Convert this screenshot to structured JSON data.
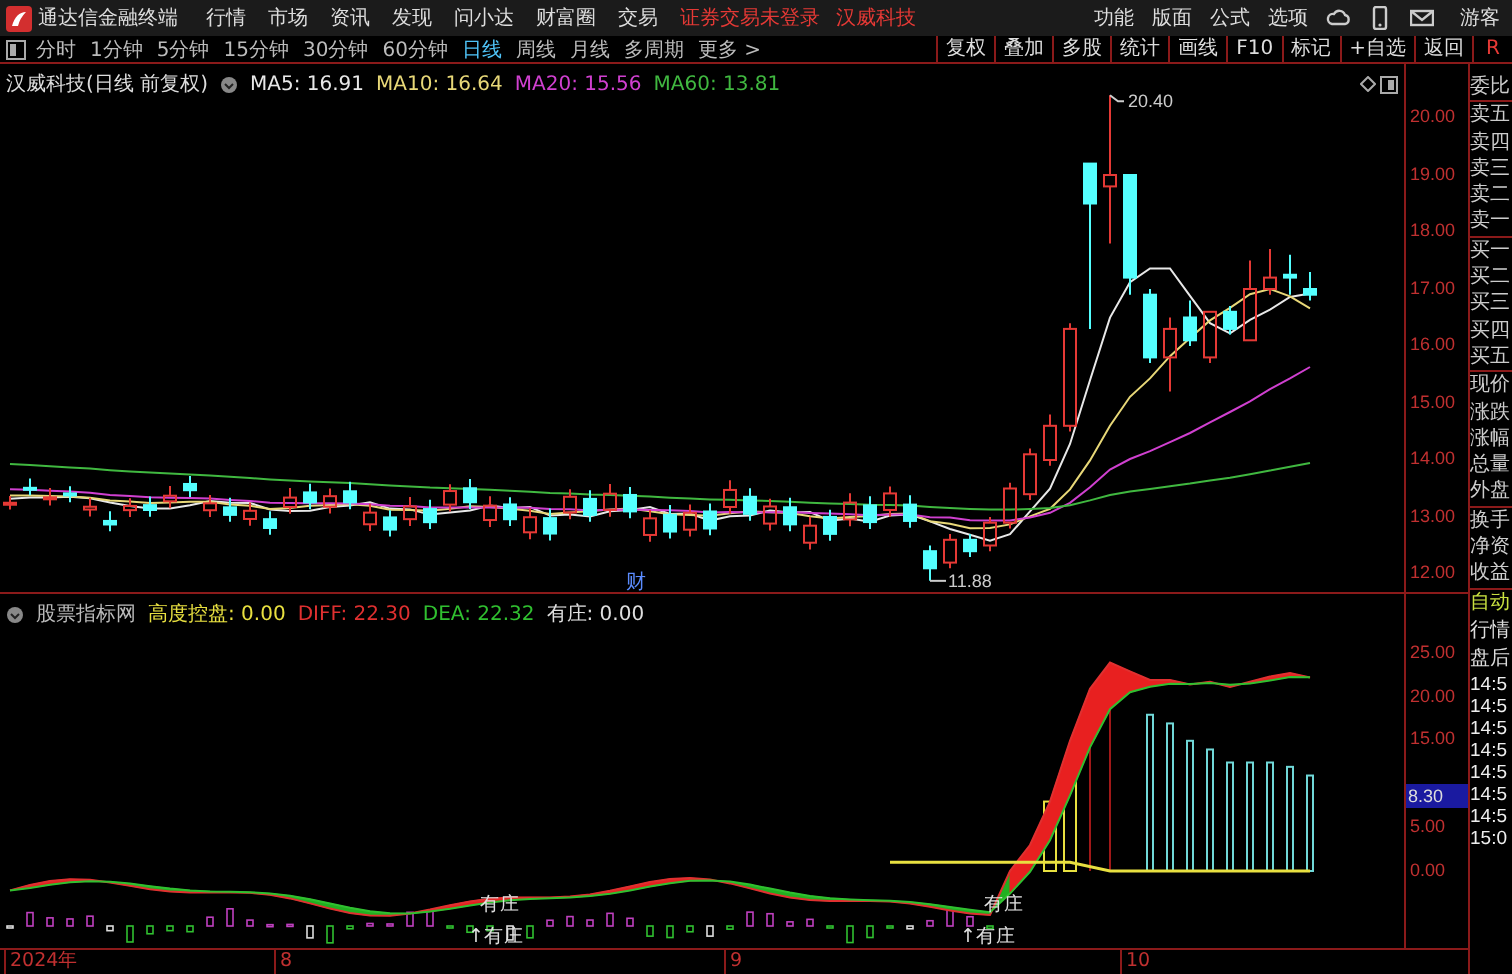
{
  "topbar": {
    "app_title": "通达信金融终端",
    "menu": [
      "行情",
      "市场",
      "资讯",
      "发现",
      "问小达",
      "财富圈",
      "交易"
    ],
    "notice": [
      "证券交易未登录",
      "汉威科技"
    ],
    "right_menu": [
      "功能",
      "版面",
      "公式",
      "选项"
    ],
    "user": "游客"
  },
  "toolbar": {
    "periods": [
      {
        "label": "分时",
        "selected": false
      },
      {
        "label": "1分钟",
        "selected": false
      },
      {
        "label": "5分钟",
        "selected": false
      },
      {
        "label": "15分钟",
        "selected": false
      },
      {
        "label": "30分钟",
        "selected": false
      },
      {
        "label": "60分钟",
        "selected": false
      },
      {
        "label": "日线",
        "selected": true
      },
      {
        "label": "周线",
        "selected": false
      },
      {
        "label": "月线",
        "selected": false
      },
      {
        "label": "多周期",
        "selected": false
      }
    ],
    "more": "更多 >",
    "tools": [
      "复权",
      "叠加",
      "多股",
      "统计",
      "画线",
      "F10",
      "标记",
      "+自选",
      "返回"
    ],
    "corner": "R"
  },
  "main_chart": {
    "title": "汉威科技(日线 前复权)",
    "indicators": [
      {
        "label": "MA5: 16.91",
        "color": "#e8e8e8"
      },
      {
        "label": "MA10: 16.64",
        "color": "#e8d878"
      },
      {
        "label": "MA20: 15.56",
        "color": "#d040d0"
      },
      {
        "label": "MA60: 13.81",
        "color": "#40b840"
      }
    ],
    "high_label": "20.40",
    "low_label": "11.88",
    "event_mark": "财",
    "axis_labels": [
      "20.00",
      "19.00",
      "18.00",
      "17.00",
      "16.00",
      "15.00",
      "14.00",
      "13.00",
      "12.00"
    ]
  },
  "sub_chart": {
    "title": "股票指标网",
    "indicators": [
      {
        "label": "高度控盘: 0.00",
        "color": "#e8e040"
      },
      {
        "label": "DIFF: 22.30",
        "color": "#e03030"
      },
      {
        "label": "DEA: 22.32",
        "color": "#30c030"
      },
      {
        "label": "有庄: 0.00",
        "color": "#e0e0e0"
      }
    ],
    "markers": [
      "有庄",
      "有庄",
      "↑有庄",
      "↑有庄"
    ],
    "axis_labels": [
      "25.00",
      "20.00",
      "15.00",
      "5.00",
      "0.00"
    ],
    "current_value": "8.30"
  },
  "date_axis": [
    "2024年",
    "8",
    "9",
    "10"
  ],
  "quote_panel": {
    "labels": [
      "委比",
      "卖五",
      "卖四",
      "卖三",
      "卖二",
      "卖一",
      "买一",
      "买二",
      "买三",
      "买四",
      "买五",
      "现价",
      "涨跌",
      "涨幅",
      "总量",
      "外盘",
      "换手",
      "净资",
      "收益"
    ],
    "modes": [
      {
        "label": "自动",
        "selected": true
      },
      {
        "label": "行情",
        "selected": false
      },
      {
        "label": "盘后",
        "selected": false
      }
    ],
    "times": [
      "14:5",
      "14:5",
      "14:5",
      "14:5",
      "14:5",
      "14:5",
      "14:5",
      "15:0"
    ]
  }
}
